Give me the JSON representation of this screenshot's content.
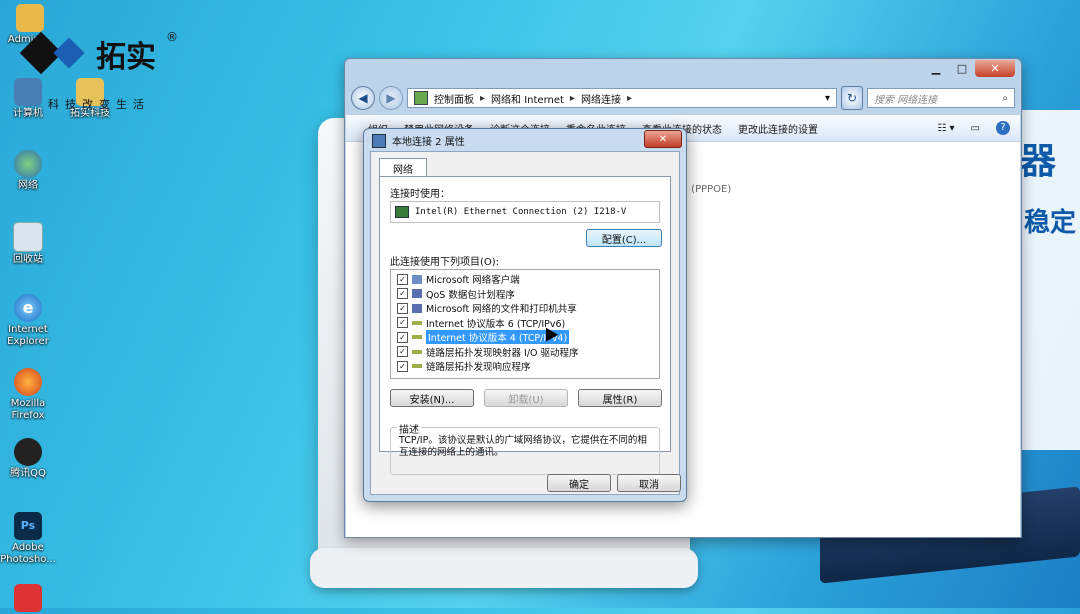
{
  "logo": {
    "brand": "拓实",
    "registered": "®",
    "slogan": "科技改变生活"
  },
  "desktop": {
    "icons": [
      {
        "label": "Admini..."
      },
      {
        "label": "计算机"
      },
      {
        "label": "拓实科技"
      },
      {
        "label": "网络"
      },
      {
        "label": "回收站"
      },
      {
        "label": "Internet Explorer"
      },
      {
        "label": "Mozilla Firefox"
      },
      {
        "label": "腾讯QQ"
      },
      {
        "label": "Adobe Photosho..."
      }
    ]
  },
  "background": {
    "promo_big": "器",
    "promo_med": "稳定"
  },
  "explorer": {
    "breadcrumb": [
      "控制面板",
      "网络和 Internet",
      "网络连接"
    ],
    "search_placeholder": "搜索 网络连接",
    "toolbar": {
      "item1": "组织",
      "item2": "禁用此网络设备",
      "item3": "诊断这个连接",
      "item4": "重命名此连接",
      "view_status": "查看此连接的状态",
      "change_settings": "更改此连接的设置"
    },
    "pppoe_text": "口 (PPPOE)"
  },
  "dialog": {
    "title": "本地连接 2 属性",
    "tab": "网络",
    "connect_using_label": "连接时使用：",
    "adapter": "Intel(R) Ethernet Connection (2) I218-V",
    "configure_button": "配置(C)...",
    "items_label": "此连接使用下列项目(O):",
    "items": [
      {
        "label": "Microsoft 网络客户端",
        "checked": true
      },
      {
        "label": "QoS 数据包计划程序",
        "checked": true
      },
      {
        "label": "Microsoft 网络的文件和打印机共享",
        "checked": true
      },
      {
        "label": "Internet 协议版本 6 (TCP/IPv6)",
        "checked": true
      },
      {
        "label": "Internet 协议版本 4 (TCP/IPv4)",
        "checked": true,
        "selected": true
      },
      {
        "label": "链路层拓扑发现映射器 I/O 驱动程序",
        "checked": true
      },
      {
        "label": "链路层拓扑发现响应程序",
        "checked": true
      }
    ],
    "install_button": "安装(N)...",
    "uninstall_button": "卸载(U)",
    "properties_button": "属性(R)",
    "description_legend": "描述",
    "description_text": "TCP/IP。该协议是默认的广域网络协议，它提供在不同的相互连接的网络上的通讯。",
    "ok_button": "确定",
    "cancel_button": "取消",
    "check_mark": "✓",
    "close_glyph": "✕"
  },
  "colors": {
    "selection": "#3399ff",
    "desktop_accent": "#2aa6d6"
  }
}
